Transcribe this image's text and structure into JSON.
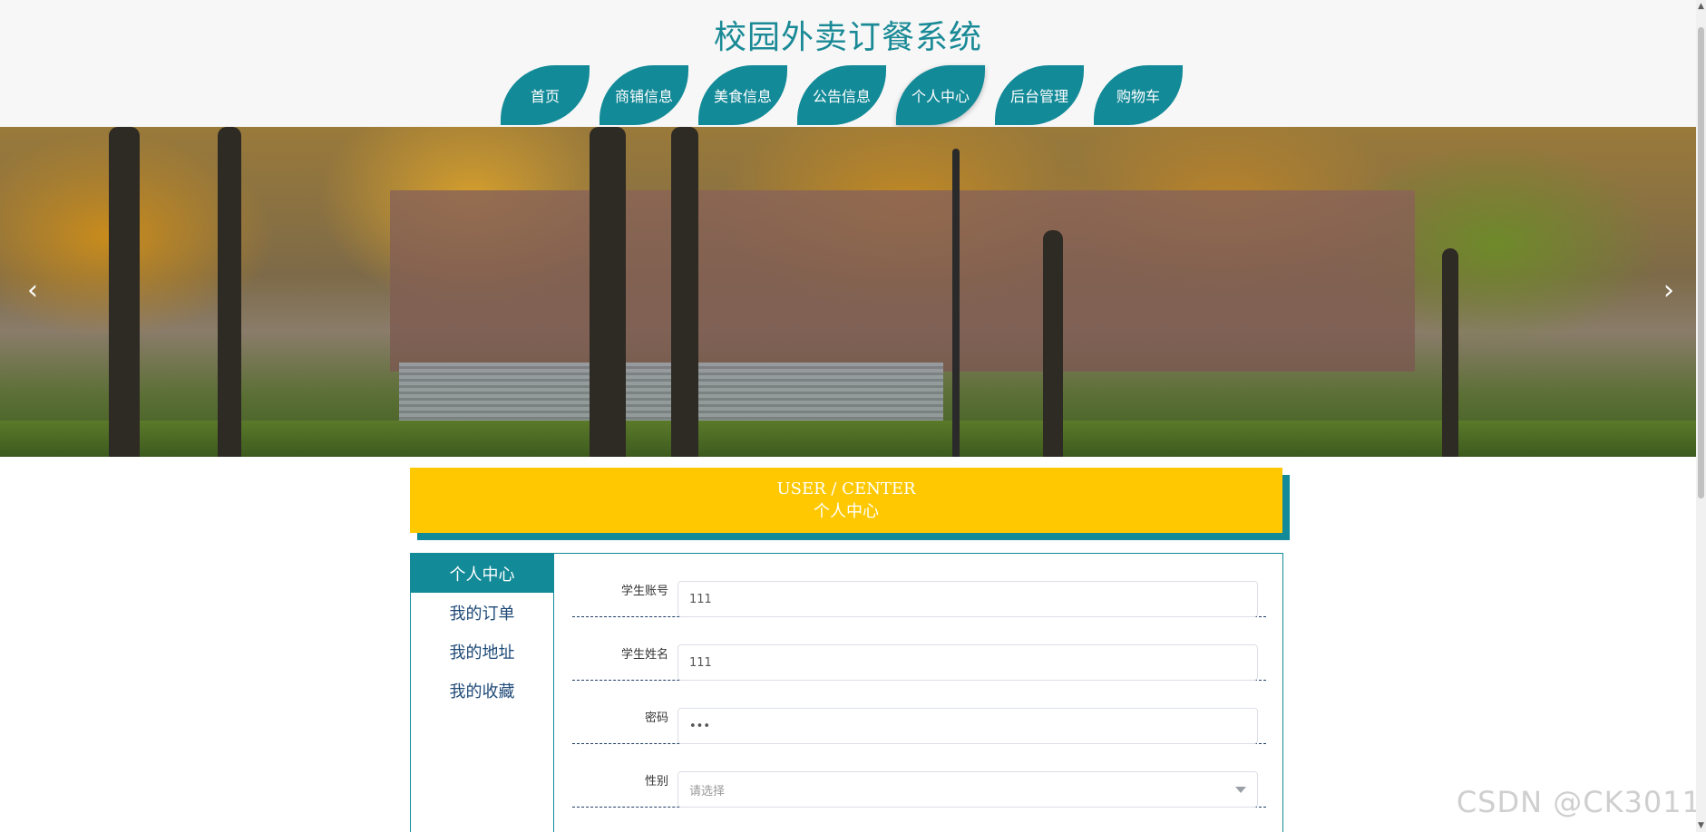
{
  "site": {
    "title": "校园外卖订餐系统"
  },
  "nav": {
    "items": [
      {
        "label": "首页"
      },
      {
        "label": "商铺信息"
      },
      {
        "label": "美食信息"
      },
      {
        "label": "公告信息"
      },
      {
        "label": "个人中心"
      },
      {
        "label": "后台管理"
      },
      {
        "label": "购物车"
      }
    ],
    "active": "个人中心"
  },
  "banner": {
    "prev_glyph": "‹",
    "next_glyph": "›"
  },
  "section": {
    "title_en": "USER / CENTER",
    "title_cn": "个人中心"
  },
  "sidebar": {
    "items": [
      {
        "label": "个人中心"
      },
      {
        "label": "我的订单"
      },
      {
        "label": "我的地址"
      },
      {
        "label": "我的收藏"
      }
    ],
    "active": "个人中心"
  },
  "form": {
    "fields": [
      {
        "label": "学生账号",
        "value": "111"
      },
      {
        "label": "学生姓名",
        "value": "111"
      },
      {
        "label": "密码",
        "value": "•••"
      },
      {
        "label": "性别",
        "placeholder": "请选择"
      }
    ]
  },
  "watermark": "CSDN @CK3011",
  "colors": {
    "primary": "#138a98",
    "accent": "#ffc800",
    "title": "#1a8a96"
  }
}
